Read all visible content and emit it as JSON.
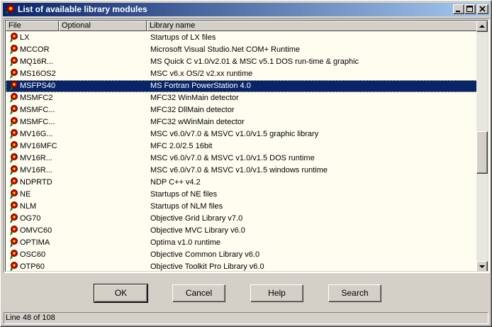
{
  "window": {
    "title": "List of available library modules",
    "controls": [
      "minimize-icon",
      "maximize-icon",
      "close-icon"
    ]
  },
  "table": {
    "columns": [
      "File",
      "Optional",
      "Library name"
    ],
    "selected_index": 6,
    "rows": [
      {
        "file": "LX",
        "optional": "",
        "name": "Startups of LX files"
      },
      {
        "file": "MCCOR",
        "optional": "",
        "name": "Microsoft Visual Studio.Net COM+ Runtime"
      },
      {
        "file": "MQ16R...",
        "optional": "",
        "name": "MS Quick C v1.0/v2.01 & MSC v5.1 DOS run-time & graphic"
      },
      {
        "file": "MS16OS2",
        "optional": "",
        "name": "MSC v6.x OS/2 v2.xx  runtime"
      },
      {
        "file": "MSFPS40",
        "optional": "",
        "name": "MS Fortran PowerStation 4.0"
      },
      {
        "file": "MSMFC2",
        "optional": "",
        "name": "MFC32 WinMain detector"
      },
      {
        "file": "MSMFC...",
        "optional": "",
        "name": "MFC32 DllMain detector"
      },
      {
        "file": "MSMFC...",
        "optional": "",
        "name": "MFC32 wWinMain detector"
      },
      {
        "file": "MV16G...",
        "optional": "",
        "name": "MSC v6.0/v7.0 & MSVC v1.0/v1.5 graphic library"
      },
      {
        "file": "MV16MFC",
        "optional": "",
        "name": "MFC 2.0/2.5 16bit"
      },
      {
        "file": "MV16R...",
        "optional": "",
        "name": "MSC v6.0/v7.0 & MSVC v1.0/v1.5 DOS runtime"
      },
      {
        "file": "MV16R...",
        "optional": "",
        "name": "MSC v6.0/v7.0 & MSVC v1.0/v1.5 windows runtime"
      },
      {
        "file": "NDPRTD",
        "optional": "",
        "name": "NDP C++ v4.2"
      },
      {
        "file": "NE",
        "optional": "",
        "name": "Startups of NE files"
      },
      {
        "file": "NLM",
        "optional": "",
        "name": "Startups of NLM files"
      },
      {
        "file": "OG70",
        "optional": "",
        "name": "Objective Grid Library v7.0"
      },
      {
        "file": "OMVC60",
        "optional": "",
        "name": "Objective MVC Library v6.0"
      },
      {
        "file": "OPTIMA",
        "optional": "",
        "name": "Optima v1.0 runtime"
      },
      {
        "file": "OSC60",
        "optional": "",
        "name": "Objective Common Library v6.0"
      },
      {
        "file": "OTP60",
        "optional": "",
        "name": "Objective Toolkit Pro Library v6.0"
      }
    ]
  },
  "buttons": {
    "ok": "OK",
    "cancel": "Cancel",
    "help": "Help",
    "search": "Search"
  },
  "status": {
    "text": "Line 48 of 108"
  },
  "colors": {
    "selection": "#0a246a",
    "list_bg": "#fffcf0",
    "icon_red": "#cc0000",
    "icon_green": "#008000"
  },
  "icons": {
    "row_icon": "library-module-icon"
  }
}
